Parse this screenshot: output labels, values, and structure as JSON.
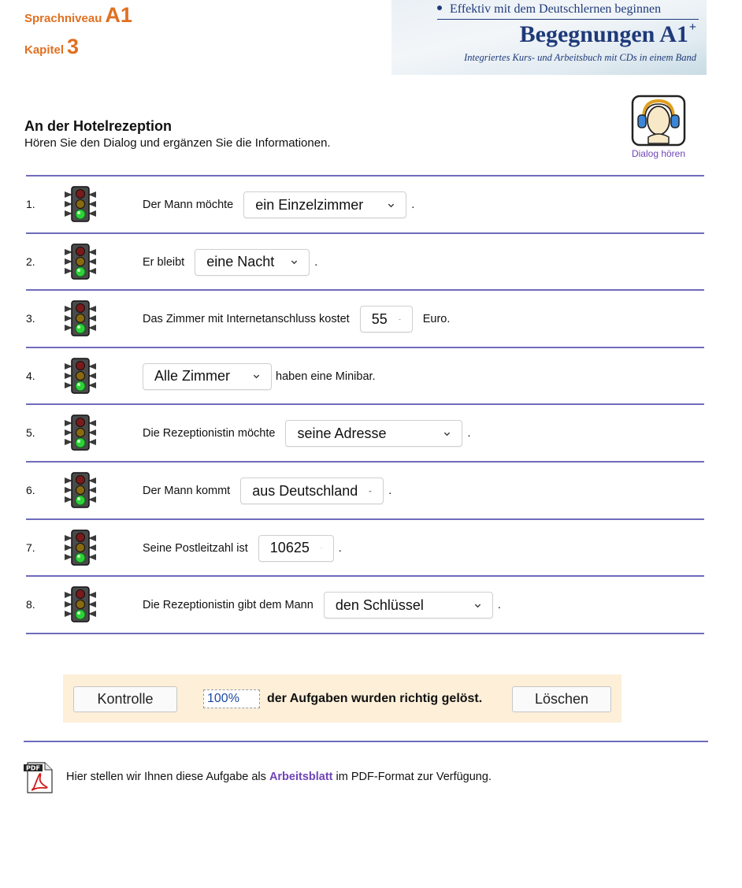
{
  "header": {
    "level_label": "Sprachniveau",
    "level_value": "A1",
    "chapter_label": "Kapitel",
    "chapter_value": "3"
  },
  "banner": {
    "tagline": "Effektiv mit dem Deutschlernen beginnen",
    "title": "Begegnungen A1",
    "title_sup": "+",
    "subtitle": "Integriertes Kurs- und Arbeitsbuch mit CDs in einem Band"
  },
  "exercise": {
    "title": "An der Hotelrezeption",
    "instruction": "Hören Sie den Dialog und ergänzen Sie die Informationen.",
    "listen_label": "Dialog hören"
  },
  "items": [
    {
      "num": "1.",
      "before": "Der Mann möchte",
      "select": "ein Einzelzimmer",
      "after": "."
    },
    {
      "num": "2.",
      "before": "Er bleibt",
      "select": "eine Nacht",
      "after": "."
    },
    {
      "num": "3.",
      "before": "Das Zimmer mit Internetanschluss kostet",
      "select": "55",
      "after": "Euro."
    },
    {
      "num": "4.",
      "before": "",
      "select": "Alle Zimmer",
      "after": "haben eine Minibar."
    },
    {
      "num": "5.",
      "before": "Die Rezeptionistin möchte",
      "select": "seine Adresse",
      "after": "."
    },
    {
      "num": "6.",
      "before": "Der Mann kommt",
      "select": "aus Deutschland",
      "after": "."
    },
    {
      "num": "7.",
      "before": "Seine Postleitzahl ist",
      "select": "10625",
      "after": "."
    },
    {
      "num": "8.",
      "before": "Die Rezeptionistin gibt dem Mann",
      "select": "den Schlüssel",
      "after": "."
    }
  ],
  "controls": {
    "check_label": "Kontrolle",
    "score_value": "100%",
    "result_text": "der Aufgaben wurden richtig gelöst.",
    "clear_label": "Löschen"
  },
  "footer": {
    "text_before": "Hier stellen wir Ihnen diese Aufgabe als",
    "link_text": "Arbeitsblatt",
    "text_after": "im PDF-Format zur Verfügung.",
    "pdf_icon_text": "PDF"
  },
  "colors": {
    "accent_orange": "#e07020",
    "divider": "#6f6cbc",
    "link": "#7045b8",
    "banner_text": "#1f3a7a",
    "panel": "#fdefd8"
  }
}
